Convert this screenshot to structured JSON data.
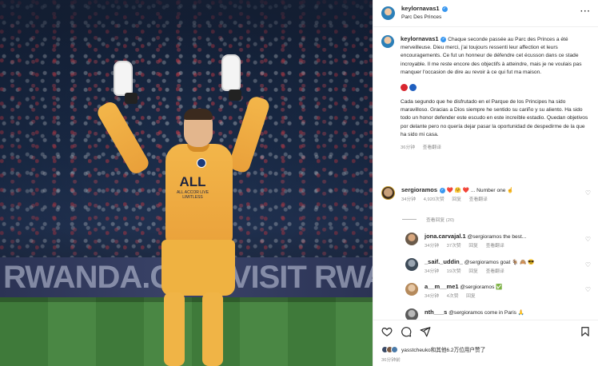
{
  "photo": {
    "banner_text": "RWANDA.COM  VISIT RWANDA  VISIT RWANDA",
    "sponsor": "ALL",
    "sponsor_sub": "ALL ACCOR LIVE LIMITLESS"
  },
  "post": {
    "username": "keylornavas1",
    "location": "Parc Des Princes",
    "caption_fr": "Chaque seconde passée au Parc des Princes a été merveilleuse. Dieu merci, j'ai toujours ressenti leur affection et leurs encouragements. Ce fut un honneur de défendre cet écusson dans ce stade incroyable. Il me reste encore des objectifs à atteindre, mais je ne voulais pas manquer l'occasion de dire au revoir à ce qui fut ma maison.",
    "caption_es": "Cada segundo que he disfrutado en el Parque de los Principes ha sido maravilloso. Gracias a Dios siempre he sentido su cariño y su aliento. Ha sido todo un honor defender este escudo en este increíble estadio. Quedan objetivos por delante pero no quería dejar pasar la oportunidad de despedirme de la que ha sido mi casa.",
    "caption_time": "36分钟",
    "translate": "查看翻译",
    "flag_colors": [
      "#d8262f",
      "#1f5fbf"
    ]
  },
  "comments": [
    {
      "username": "sergioramos",
      "text": "❤️ 🤗 ❤️ ... Number one ☝️",
      "time": "34分钟",
      "likes": "4,920次赞",
      "reply": "回复",
      "translate": "查看翻译"
    }
  ],
  "view_replies": "查看回复 (20)",
  "replies": [
    {
      "username": "jona.carvajal.1",
      "text": "@sergioramos the best...",
      "time": "34分钟",
      "likes": "37次赞",
      "reply": "回复",
      "translate": "查看翻译"
    },
    {
      "username": "_saif._uddin_",
      "text": "@sergioramos goat 🐐 🙈 😎",
      "time": "34分钟",
      "likes": "19次赞",
      "reply": "回复",
      "translate": "查看翻译"
    },
    {
      "username": "a__m__me1",
      "text": "@sergioramos ✅",
      "time": "34分钟",
      "likes": "4次赞",
      "reply": "回复",
      "translate": ""
    },
    {
      "username": "nth___s",
      "text": "@sergioramos come in Paris 🙏",
      "time": "",
      "likes": "",
      "reply": "",
      "translate": ""
    }
  ],
  "footer": {
    "likes_text": "yasstcheuko和其他6.2万位用户赞了",
    "posted": "36分钟前",
    "icons": [
      "heart-icon",
      "comment-icon",
      "share-icon",
      "bookmark-icon"
    ]
  }
}
